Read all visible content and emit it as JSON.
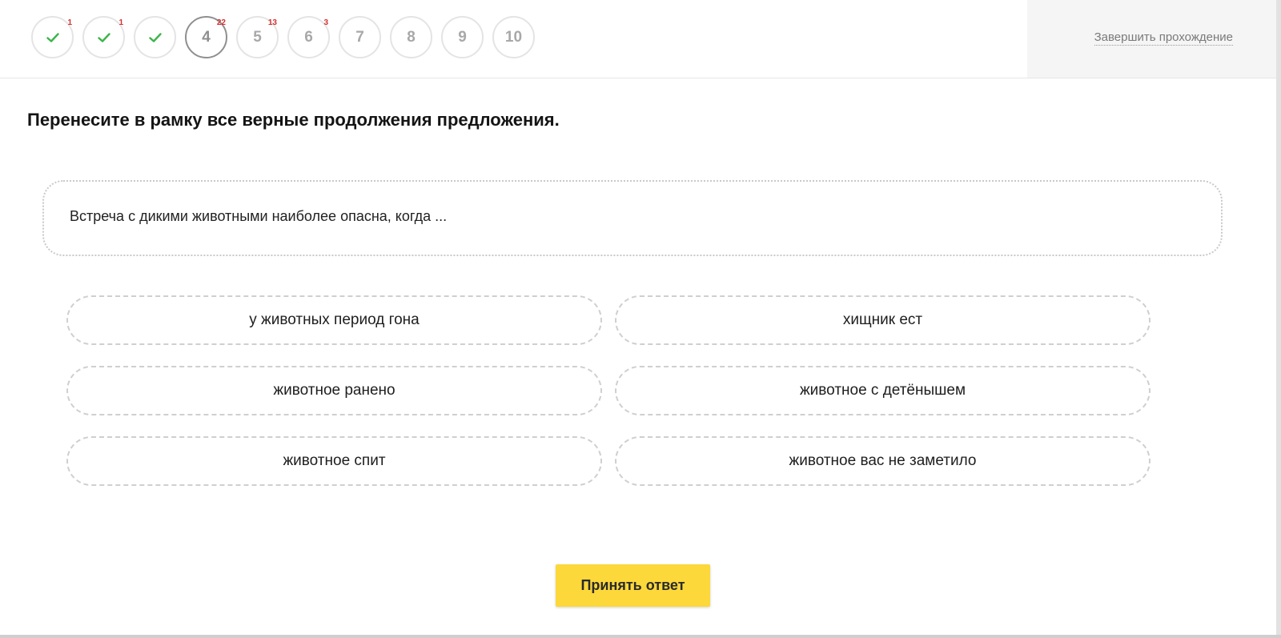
{
  "steps": [
    {
      "label": "1",
      "status": "done",
      "icon": "check-icon",
      "badge": "1"
    },
    {
      "label": "2",
      "status": "done",
      "icon": "check-icon",
      "badge": "1"
    },
    {
      "label": "3",
      "status": "done",
      "icon": "check-icon",
      "badge": ""
    },
    {
      "label": "4",
      "status": "current",
      "badge": "22"
    },
    {
      "label": "5",
      "status": "pending",
      "badge": "13"
    },
    {
      "label": "6",
      "status": "pending",
      "badge": "3"
    },
    {
      "label": "7",
      "status": "pending",
      "badge": ""
    },
    {
      "label": "8",
      "status": "pending",
      "badge": ""
    },
    {
      "label": "9",
      "status": "pending",
      "badge": ""
    },
    {
      "label": "10",
      "status": "pending",
      "badge": ""
    }
  ],
  "header": {
    "finish_label": "Завершить прохождение"
  },
  "task": {
    "title": "Перенесите в рамку все верные продолжения предложения.",
    "prompt": "Встреча с дикими животными наиболее опасна, когда ...",
    "options": [
      "у животных период гона",
      "хищник ест",
      "животное ранено",
      "животное с детёнышем",
      "животное спит",
      "животное вас не заметило"
    ],
    "submit_label": "Принять ответ"
  },
  "colors": {
    "check": "#3bb54a",
    "badge": "#d62e2e",
    "submit_bg": "#fcd83a"
  }
}
